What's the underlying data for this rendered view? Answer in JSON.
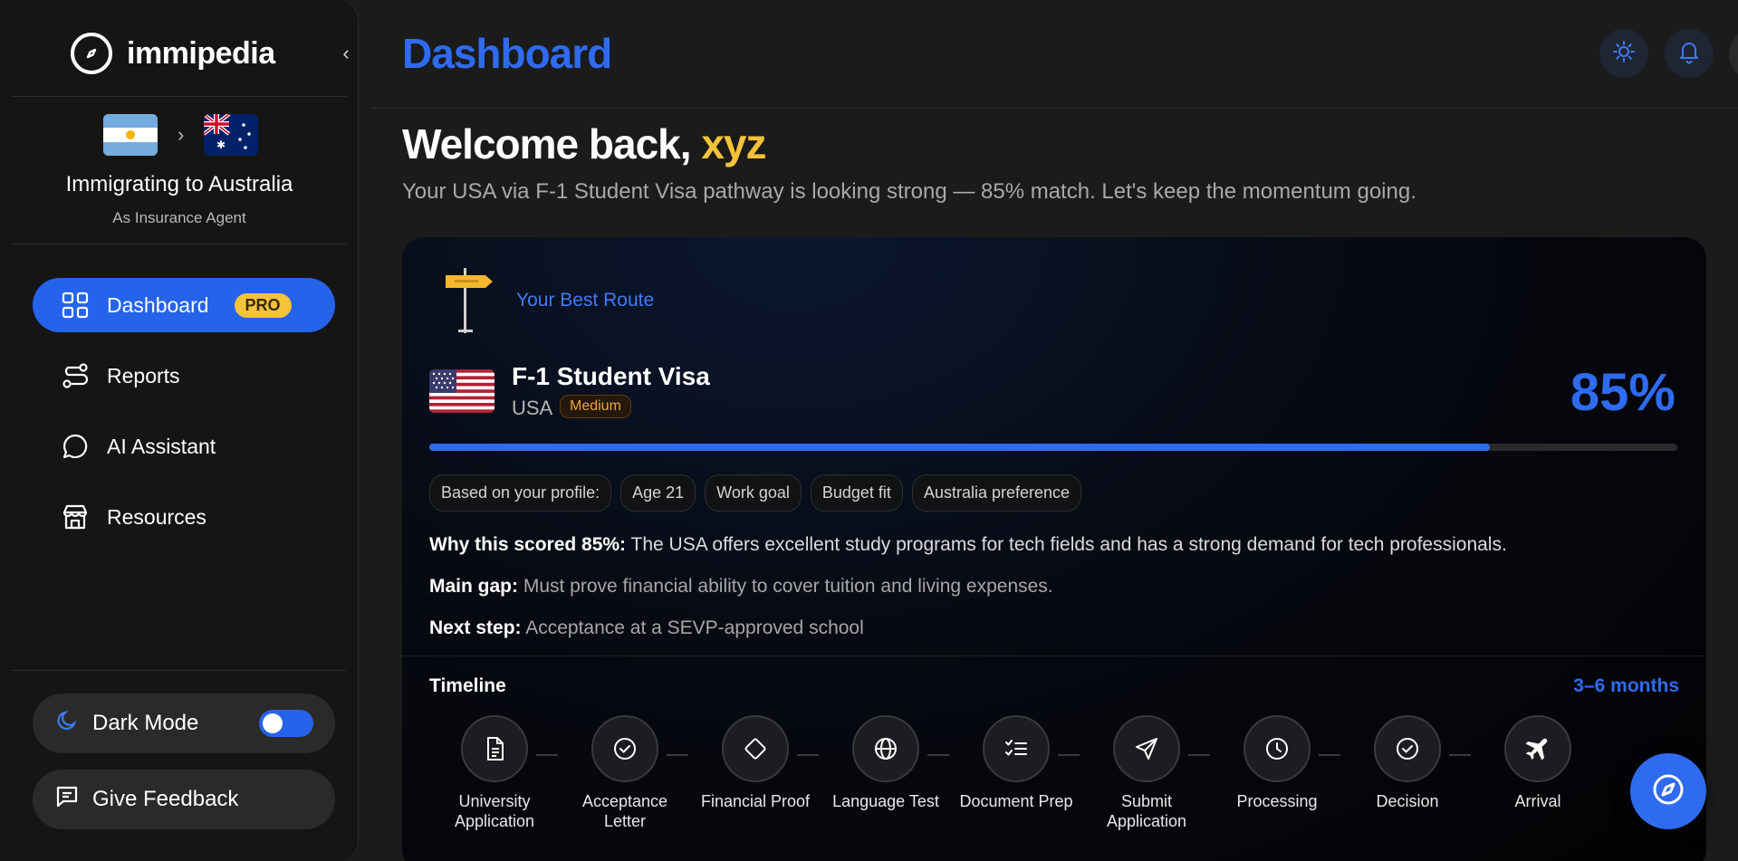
{
  "brand": {
    "name": "immipedia",
    "icon": "compass-icon"
  },
  "sidebar": {
    "collapse_icon": "chevron-left-icon",
    "origin_flag": "argentina-flag",
    "destination_flag": "australia-flag",
    "immigration_title": "Immigrating to Australia",
    "immigration_subtitle": "As Insurance Agent",
    "nav": [
      {
        "label": "Dashboard",
        "icon": "grid-icon",
        "badge": "PRO",
        "active": true
      },
      {
        "label": "Reports",
        "icon": "route-icon"
      },
      {
        "label": "AI Assistant",
        "icon": "chat-bubble-icon"
      },
      {
        "label": "Resources",
        "icon": "store-icon"
      }
    ],
    "dark_mode_label": "Dark Mode",
    "dark_mode_on": true,
    "feedback_label": "Give Feedback"
  },
  "header": {
    "title": "Dashboard",
    "theme_icon": "sun-icon",
    "notification_icon": "bell-icon"
  },
  "welcome": {
    "greeting": "Welcome back, ",
    "user": "xyz",
    "subtitle": "Your USA via F-1 Student Visa pathway is looking strong — 85% match. Let's keep the momentum going."
  },
  "route": {
    "label": "Your Best Route",
    "visa": "F-1 Student Visa",
    "country": "USA",
    "difficulty": "Medium",
    "score": "85%",
    "match_fraction": 0.85,
    "chips": [
      "Based on your profile:",
      "Age 21",
      "Work goal",
      "Budget fit",
      "Australia preference"
    ],
    "why_label": "Why this scored 85%:",
    "why_text": " The USA offers excellent study programs for tech fields and has a strong demand for tech professionals.",
    "gap_label": "Main gap:",
    "gap_text": " Must prove financial ability to cover tuition and living expenses.",
    "next_label": "Next step:",
    "next_text": " Acceptance at a SEVP-approved school"
  },
  "timeline": {
    "title": "Timeline",
    "duration": "3–6 months",
    "steps": [
      {
        "label": "University Application",
        "icon": "document-icon"
      },
      {
        "label": "Acceptance Letter",
        "icon": "check-circle-icon"
      },
      {
        "label": "Financial Proof",
        "icon": "diamond-icon"
      },
      {
        "label": "Language Test",
        "icon": "globe-icon"
      },
      {
        "label": "Document Prep",
        "icon": "checklist-icon"
      },
      {
        "label": "Submit Application",
        "icon": "send-icon"
      },
      {
        "label": "Processing",
        "icon": "clock-icon"
      },
      {
        "label": "Decision",
        "icon": "check-circle-icon"
      },
      {
        "label": "Arrival",
        "icon": "plane-icon"
      }
    ]
  },
  "fab_icon": "compass-icon"
}
